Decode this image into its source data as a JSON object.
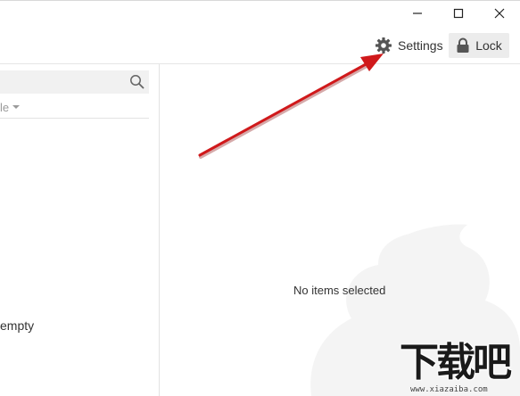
{
  "window": {
    "controls": [
      {
        "name": "minimize",
        "icon": "minimize-icon"
      },
      {
        "name": "maximize",
        "icon": "maximize-icon"
      },
      {
        "name": "close",
        "icon": "close-icon"
      }
    ]
  },
  "toolbar": {
    "settings_label": "Settings",
    "settings_icon": "gear-icon",
    "lock_label": "Lock",
    "lock_icon": "lock-icon"
  },
  "left_pane": {
    "search": {
      "icon": "search-icon"
    },
    "filter": {
      "label_fragment": "le",
      "icon": "caret-down-icon"
    },
    "empty_text_fragment": "empty"
  },
  "right_pane": {
    "placeholder": "No items selected"
  },
  "annotation": {
    "arrow_color": "#d0191b"
  },
  "watermark": {
    "logo_text": "下载吧",
    "url": "www.xiazaiba.com"
  },
  "colors": {
    "lock_bg": "#ececec",
    "search_bg": "#f1f1f1",
    "watermark_shape": "#f4f4f4"
  }
}
